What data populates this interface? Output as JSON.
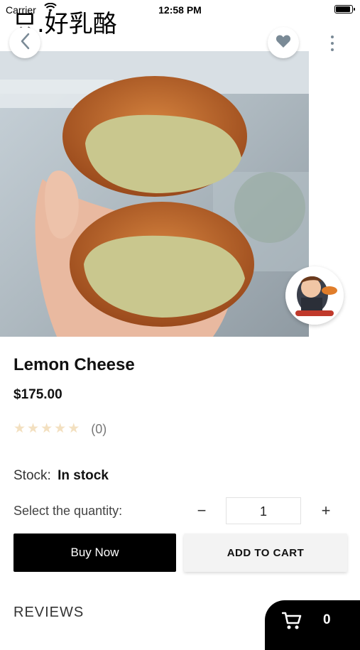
{
  "status_bar": {
    "carrier": "Carrier",
    "time": "12:58 PM"
  },
  "shop_name": "只.好乳酪",
  "product": {
    "name": "Lemon Cheese",
    "price": "$175.00",
    "rating_count": "(0)",
    "stars": 0,
    "stock_label": "Stock:",
    "stock_value": "In stock"
  },
  "quantity": {
    "label": "Select the quantity:",
    "value": "1",
    "minus": "−",
    "plus": "+"
  },
  "actions": {
    "buy_now": "Buy Now",
    "add_to_cart": "ADD TO CART"
  },
  "reviews": {
    "title": "REVIEWS"
  },
  "cart": {
    "count": "0"
  },
  "icons": {
    "back": "chevron-left-icon",
    "favorite": "heart-icon",
    "more": "more-vertical-icon",
    "cart": "shopping-cart-icon",
    "star": "star-icon",
    "vendor": "vendor-logo"
  },
  "colors": {
    "primary": "#000000",
    "star_empty": "#f3e0c0",
    "secondary_button": "#f3f3f3",
    "icon_gray": "#7a8a96"
  }
}
